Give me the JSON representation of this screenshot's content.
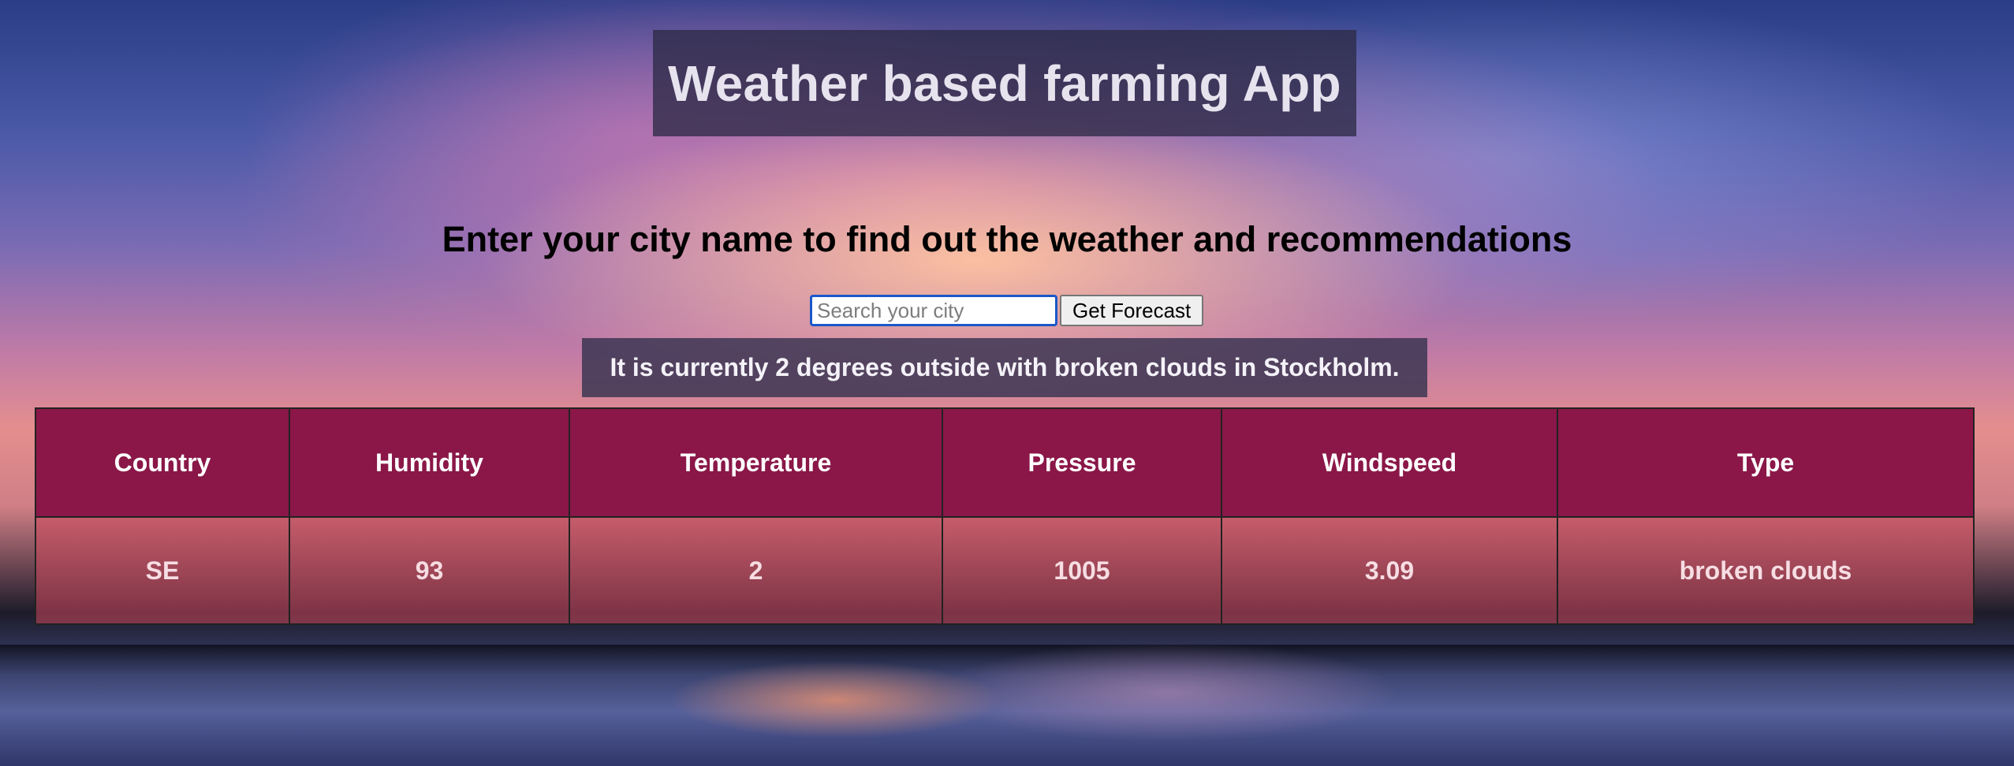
{
  "app": {
    "title": "Weather based farming App",
    "subtitle": "Enter your city name to find out the weather and recommendations"
  },
  "search": {
    "placeholder": "Search your city",
    "value": "",
    "button_label": "Get Forecast"
  },
  "status": {
    "text": "It is currently 2 degrees outside with broken clouds in Stockholm."
  },
  "table": {
    "headers": [
      "Country",
      "Humidity",
      "Temperature",
      "Pressure",
      "Windspeed",
      "Type"
    ],
    "rows": [
      [
        "SE",
        "93",
        "2",
        "1005",
        "3.09",
        "broken clouds"
      ]
    ]
  },
  "colors": {
    "header_bg": "#8a1748",
    "input_focus": "#1b57c9"
  }
}
